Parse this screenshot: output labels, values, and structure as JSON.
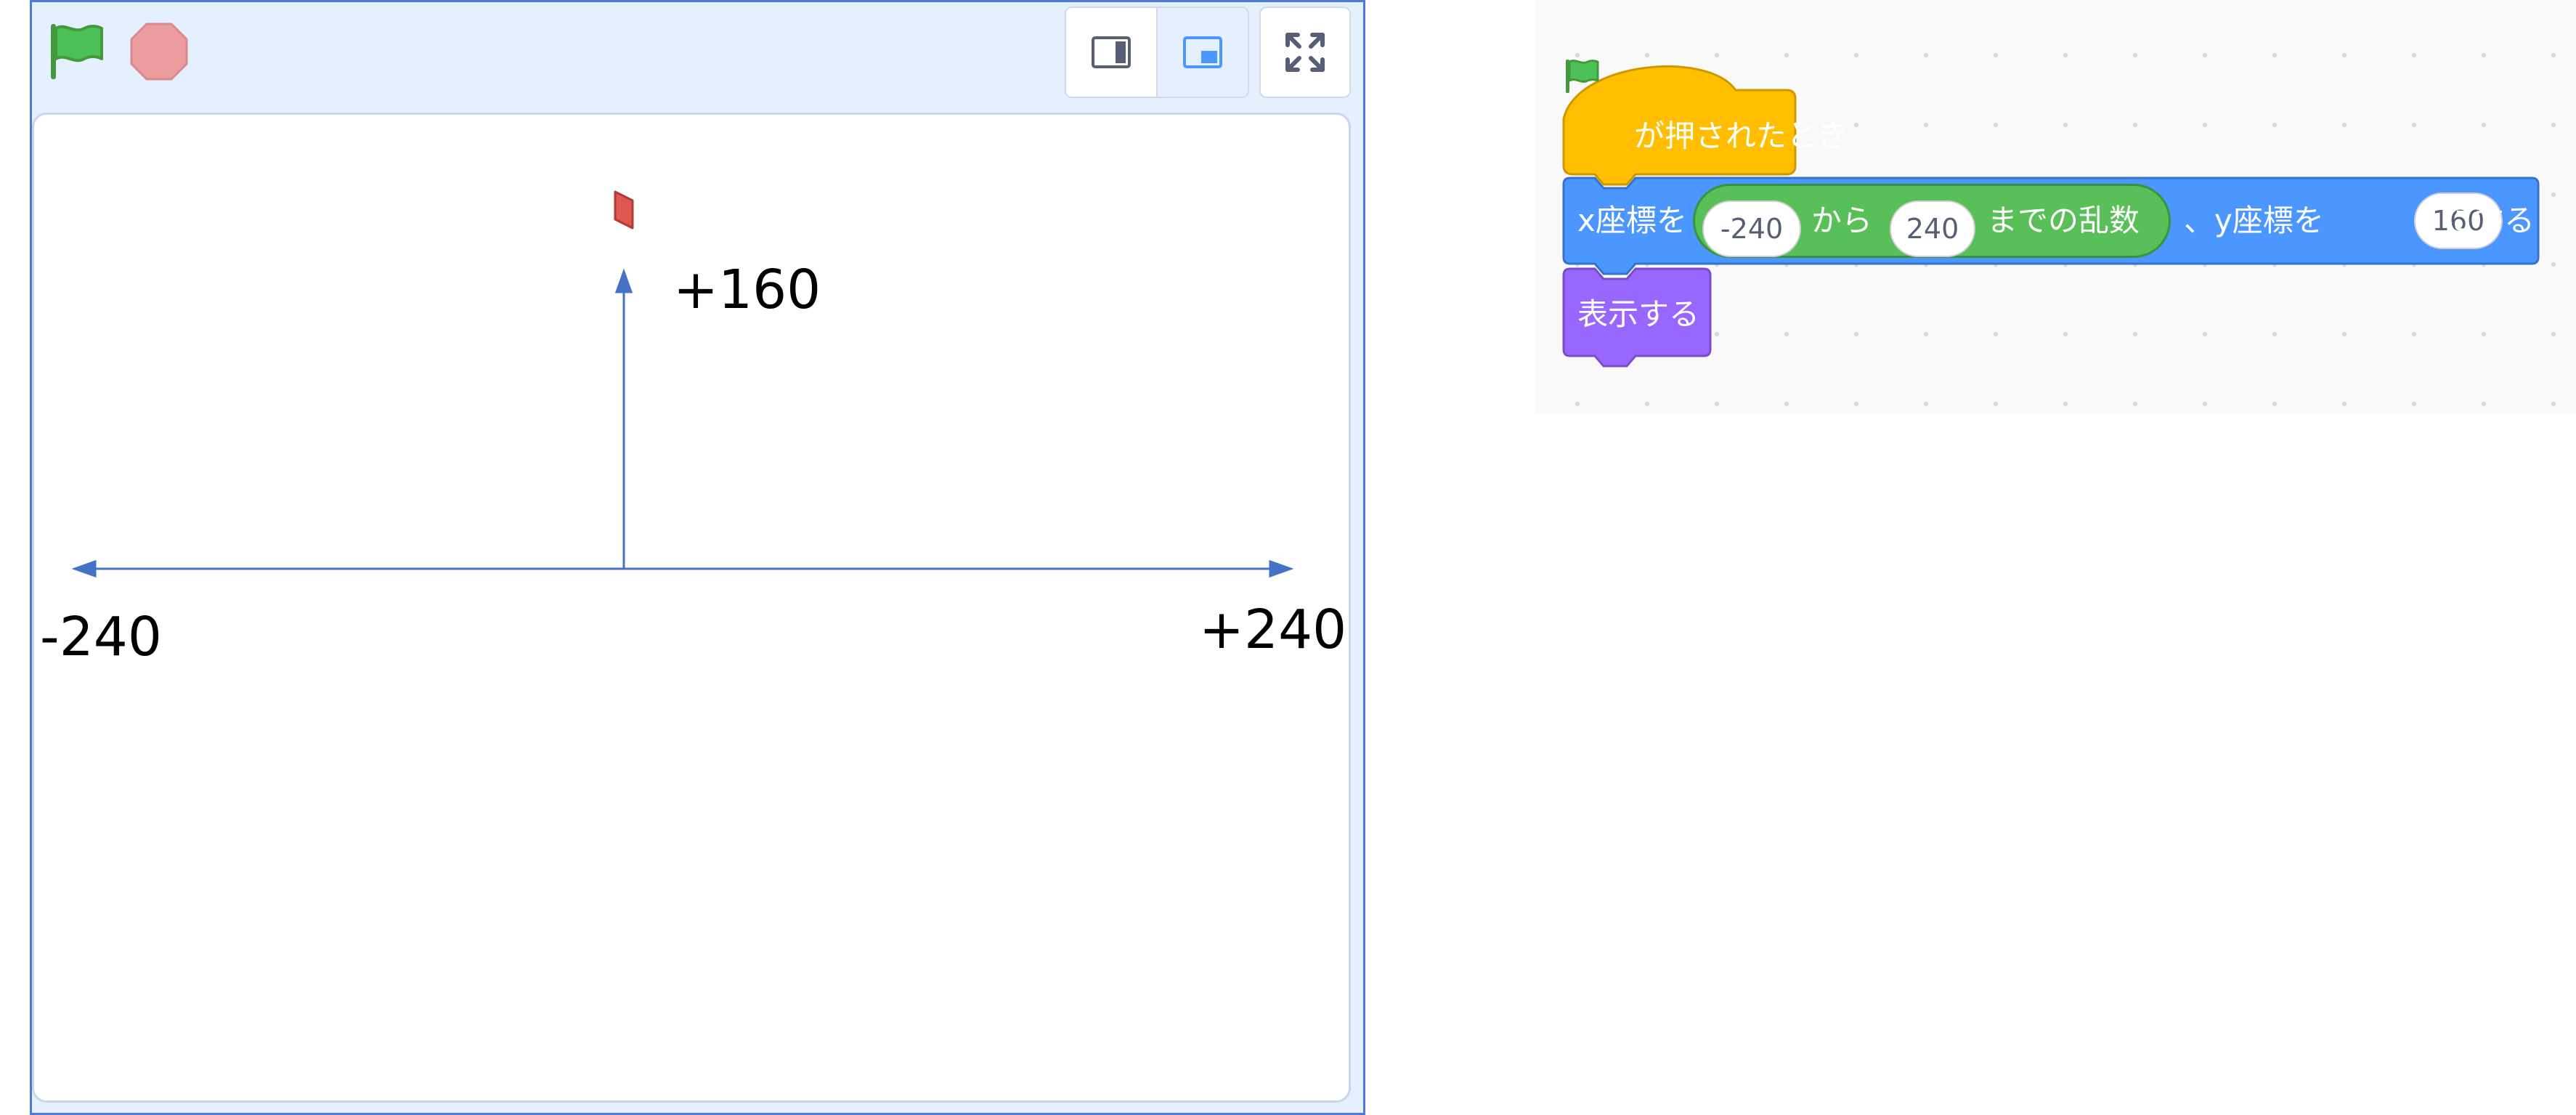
{
  "stage": {
    "header": {
      "flag_icon": "green-flag-icon",
      "stop_icon": "stop-icon",
      "small_mode_icon": "small-stage-icon",
      "normal_mode_icon": "normal-stage-icon",
      "fullscreen_icon": "fullscreen-icon"
    },
    "annotations": {
      "y_label": "+160",
      "x_min_label": "-240",
      "x_max_label": "+240",
      "arrow_color": "#4472c4"
    },
    "sprite_color": "#e0574f"
  },
  "code": {
    "hat": {
      "label": "が押されたとき",
      "color": "#ffbf00",
      "border": "#cc9900"
    },
    "motion": {
      "label_x": "x座標を",
      "from_value": "-240",
      "from_label": "から",
      "to_value": "240",
      "random_label": "までの乱数",
      "label_y": "、y座標を",
      "y_value": "160",
      "end_label": "にする",
      "color": "#4c97ff",
      "border": "#3373cc",
      "operator_color": "#59c059"
    },
    "looks": {
      "label": "表示する",
      "color": "#9966ff",
      "border": "#774dcb"
    }
  },
  "colors": {
    "stage_border": "#4c7bd9",
    "header_bg": "#e5f0ff",
    "flag_green": "#4cbf56",
    "stop_red": "#ec9c9c"
  }
}
